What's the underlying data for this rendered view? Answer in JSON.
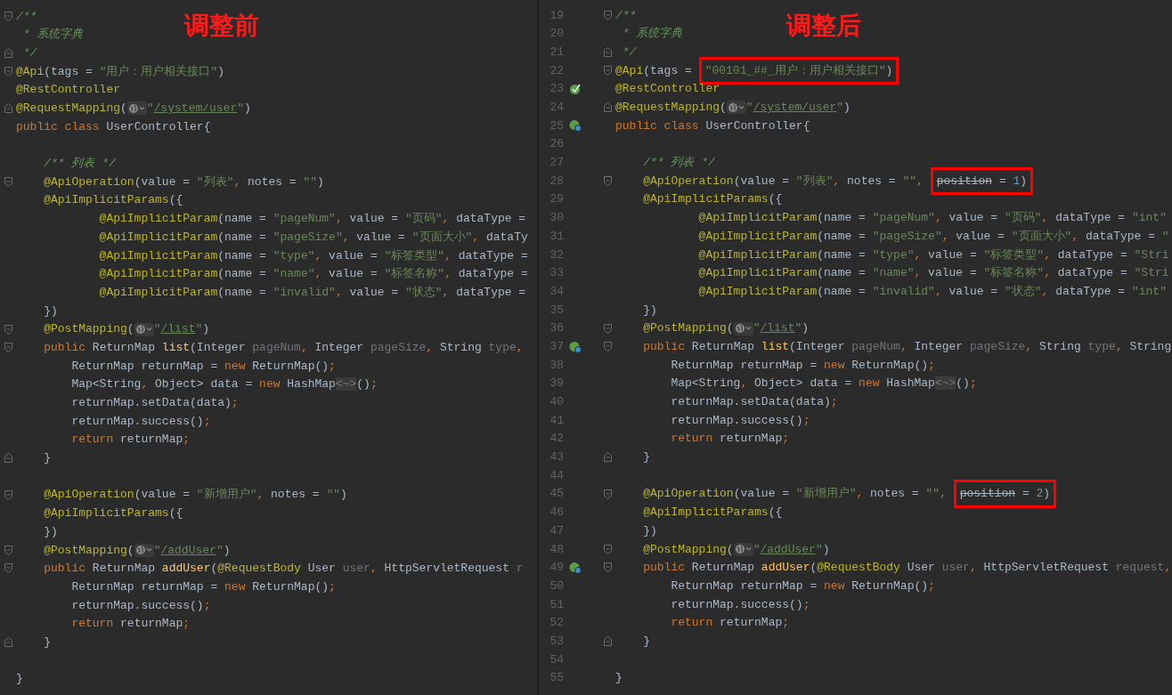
{
  "panes": [
    {
      "heading": "调整前",
      "blocks": [
        {
          "lines": [
            {
              "fold": {
                "kind": "start"
              },
              "tokens": [
                {
                  "kind": "c",
                  "text": "/**"
                }
              ]
            },
            {
              "tokens": [
                {
                  "kind": "c",
                  "text": " * 系统字典"
                }
              ]
            },
            {
              "fold": {
                "kind": "end"
              },
              "tokens": [
                {
                  "kind": "c",
                  "text": " */"
                }
              ]
            },
            {
              "fold": {
                "kind": "start"
              },
              "tokens": [
                {
                  "kind": "a",
                  "text": "@Api"
                },
                {
                  "kind": "p",
                  "text": "(tags = "
                },
                {
                  "kind": "s",
                  "text": "\"用户：用户相关接口\""
                },
                {
                  "kind": "p",
                  "text": ")"
                }
              ]
            },
            {
              "tokens": [
                {
                  "kind": "a",
                  "text": "@RestController"
                }
              ]
            },
            {
              "fold": {
                "kind": "end"
              },
              "tokens": [
                {
                  "kind": "a",
                  "text": "@RequestMapping"
                },
                {
                  "kind": "p",
                  "text": "("
                },
                {
                  "kind": "globe"
                },
                {
                  "kind": "s",
                  "text": "\""
                },
                {
                  "kind": "u",
                  "text": "/system/user"
                },
                {
                  "kind": "s",
                  "text": "\""
                },
                {
                  "kind": "p",
                  "text": ")"
                }
              ]
            },
            {
              "tokens": [
                {
                  "kind": "k",
                  "text": "public class "
                },
                {
                  "kind": "p",
                  "text": "UserController{"
                }
              ]
            }
          ]
        },
        {
          "lines": [
            {
              "tokens": [
                {
                  "kind": "c",
                  "text": "    /** 列表 */"
                }
              ]
            },
            {
              "fold": {
                "kind": "start"
              },
              "tokens": [
                {
                  "kind": "a",
                  "text": "    @ApiOperation"
                },
                {
                  "kind": "p",
                  "text": "(value = "
                },
                {
                  "kind": "s",
                  "text": "\"列表\""
                },
                {
                  "kind": "k",
                  "text": ", "
                },
                {
                  "kind": "p",
                  "text": "notes = "
                },
                {
                  "kind": "s",
                  "text": "\"\""
                },
                {
                  "kind": "p",
                  "text": ")"
                }
              ]
            },
            {
              "tokens": [
                {
                  "kind": "a",
                  "text": "    @ApiImplicitParams"
                },
                {
                  "kind": "p",
                  "text": "({"
                }
              ]
            },
            {
              "tokens": [
                {
                  "kind": "a",
                  "text": "            @ApiImplicitParam"
                },
                {
                  "kind": "p",
                  "text": "(name = "
                },
                {
                  "kind": "s",
                  "text": "\"pageNum\""
                },
                {
                  "kind": "k",
                  "text": ", "
                },
                {
                  "kind": "p",
                  "text": "value = "
                },
                {
                  "kind": "s",
                  "text": "\"页码\""
                },
                {
                  "kind": "k",
                  "text": ", "
                },
                {
                  "kind": "p",
                  "text": "dataType ="
                }
              ]
            },
            {
              "tokens": [
                {
                  "kind": "a",
                  "text": "            @ApiImplicitParam"
                },
                {
                  "kind": "p",
                  "text": "(name = "
                },
                {
                  "kind": "s",
                  "text": "\"pageSize\""
                },
                {
                  "kind": "k",
                  "text": ", "
                },
                {
                  "kind": "p",
                  "text": "value = "
                },
                {
                  "kind": "s",
                  "text": "\"页面大小\""
                },
                {
                  "kind": "k",
                  "text": ", "
                },
                {
                  "kind": "p",
                  "text": "dataTy"
                }
              ]
            },
            {
              "tokens": [
                {
                  "kind": "a",
                  "text": "            @ApiImplicitParam"
                },
                {
                  "kind": "p",
                  "text": "(name = "
                },
                {
                  "kind": "s",
                  "text": "\"type\""
                },
                {
                  "kind": "k",
                  "text": ", "
                },
                {
                  "kind": "p",
                  "text": "value = "
                },
                {
                  "kind": "s",
                  "text": "\"标签类型\""
                },
                {
                  "kind": "k",
                  "text": ", "
                },
                {
                  "kind": "p",
                  "text": "dataType ="
                }
              ]
            },
            {
              "tokens": [
                {
                  "kind": "a",
                  "text": "            @ApiImplicitParam"
                },
                {
                  "kind": "p",
                  "text": "(name = "
                },
                {
                  "kind": "s",
                  "text": "\"name\""
                },
                {
                  "kind": "k",
                  "text": ", "
                },
                {
                  "kind": "p",
                  "text": "value = "
                },
                {
                  "kind": "s",
                  "text": "\"标签名称\""
                },
                {
                  "kind": "k",
                  "text": ", "
                },
                {
                  "kind": "p",
                  "text": "dataType ="
                }
              ]
            },
            {
              "tokens": [
                {
                  "kind": "a",
                  "text": "            @ApiImplicitParam"
                },
                {
                  "kind": "p",
                  "text": "(name = "
                },
                {
                  "kind": "s",
                  "text": "\"invalid\""
                },
                {
                  "kind": "k",
                  "text": ", "
                },
                {
                  "kind": "p",
                  "text": "value = "
                },
                {
                  "kind": "s",
                  "text": "\"状态\""
                },
                {
                  "kind": "k",
                  "text": ", "
                },
                {
                  "kind": "p",
                  "text": "dataType ="
                }
              ]
            },
            {
              "tokens": [
                {
                  "kind": "p",
                  "text": "    })"
                }
              ]
            },
            {
              "fold": {
                "kind": "start"
              },
              "tokens": [
                {
                  "kind": "a",
                  "text": "    @PostMapping"
                },
                {
                  "kind": "p",
                  "text": "("
                },
                {
                  "kind": "globe"
                },
                {
                  "kind": "s",
                  "text": "\""
                },
                {
                  "kind": "u",
                  "text": "/list"
                },
                {
                  "kind": "s",
                  "text": "\""
                },
                {
                  "kind": "p",
                  "text": ")"
                }
              ]
            },
            {
              "fold": {
                "kind": "start"
              },
              "tokens": [
                {
                  "kind": "k",
                  "text": "    public "
                },
                {
                  "kind": "p",
                  "text": "ReturnMap "
                },
                {
                  "kind": "m",
                  "text": "list"
                },
                {
                  "kind": "p",
                  "text": "(Integer "
                },
                {
                  "kind": "g",
                  "text": "pageNum"
                },
                {
                  "kind": "k",
                  "text": ", "
                },
                {
                  "kind": "p",
                  "text": "Integer "
                },
                {
                  "kind": "g",
                  "text": "pageSize"
                },
                {
                  "kind": "k",
                  "text": ", "
                },
                {
                  "kind": "p",
                  "text": "String "
                },
                {
                  "kind": "g",
                  "text": "type"
                },
                {
                  "kind": "k",
                  "text": ","
                }
              ]
            },
            {
              "tokens": [
                {
                  "kind": "p",
                  "text": "        ReturnMap returnMap = "
                },
                {
                  "kind": "k",
                  "text": "new "
                },
                {
                  "kind": "p",
                  "text": "ReturnMap()"
                },
                {
                  "kind": "k",
                  "text": ";"
                }
              ]
            },
            {
              "tokens": [
                {
                  "kind": "p",
                  "text": "        Map<String"
                },
                {
                  "kind": "k",
                  "text": ", "
                },
                {
                  "kind": "p",
                  "text": "Object> data = "
                },
                {
                  "kind": "k",
                  "text": "new "
                },
                {
                  "kind": "p",
                  "text": "HashMap"
                },
                {
                  "kind": "h",
                  "text": "<~>"
                },
                {
                  "kind": "p",
                  "text": "()"
                },
                {
                  "kind": "k",
                  "text": ";"
                }
              ]
            },
            {
              "tokens": [
                {
                  "kind": "p",
                  "text": "        returnMap.setData(data)"
                },
                {
                  "kind": "k",
                  "text": ";"
                }
              ]
            },
            {
              "tokens": [
                {
                  "kind": "p",
                  "text": "        returnMap.success()"
                },
                {
                  "kind": "k",
                  "text": ";"
                }
              ]
            },
            {
              "tokens": [
                {
                  "kind": "k",
                  "text": "        return "
                },
                {
                  "kind": "p",
                  "text": "returnMap"
                },
                {
                  "kind": "k",
                  "text": ";"
                }
              ]
            },
            {
              "fold": {
                "kind": "end"
              },
              "tokens": [
                {
                  "kind": "p",
                  "text": "    }"
                }
              ]
            }
          ]
        },
        {
          "lines": [
            {
              "fold": {
                "kind": "start"
              },
              "tokens": [
                {
                  "kind": "a",
                  "text": "    @ApiOperation"
                },
                {
                  "kind": "p",
                  "text": "(value = "
                },
                {
                  "kind": "s",
                  "text": "\"新增用户\""
                },
                {
                  "kind": "k",
                  "text": ", "
                },
                {
                  "kind": "p",
                  "text": "notes = "
                },
                {
                  "kind": "s",
                  "text": "\"\""
                },
                {
                  "kind": "p",
                  "text": ")"
                }
              ]
            },
            {
              "tokens": [
                {
                  "kind": "a",
                  "text": "    @ApiImplicitParams"
                },
                {
                  "kind": "p",
                  "text": "({"
                }
              ]
            },
            {
              "tokens": [
                {
                  "kind": "p",
                  "text": "    })"
                }
              ]
            },
            {
              "fold": {
                "kind": "start"
              },
              "tokens": [
                {
                  "kind": "a",
                  "text": "    @PostMapping"
                },
                {
                  "kind": "p",
                  "text": "("
                },
                {
                  "kind": "globe"
                },
                {
                  "kind": "s",
                  "text": "\""
                },
                {
                  "kind": "u",
                  "text": "/addUser"
                },
                {
                  "kind": "s",
                  "text": "\""
                },
                {
                  "kind": "p",
                  "text": ")"
                }
              ]
            },
            {
              "fold": {
                "kind": "start"
              },
              "tokens": [
                {
                  "kind": "k",
                  "text": "    public "
                },
                {
                  "kind": "p",
                  "text": "ReturnMap "
                },
                {
                  "kind": "m",
                  "text": "addUser"
                },
                {
                  "kind": "p",
                  "text": "("
                },
                {
                  "kind": "a",
                  "text": "@RequestBody"
                },
                {
                  "kind": "p",
                  "text": " User "
                },
                {
                  "kind": "g",
                  "text": "user"
                },
                {
                  "kind": "k",
                  "text": ", "
                },
                {
                  "kind": "p",
                  "text": "HttpServletRequest "
                },
                {
                  "kind": "g",
                  "text": "r"
                }
              ]
            },
            {
              "tokens": [
                {
                  "kind": "p",
                  "text": "        ReturnMap returnMap = "
                },
                {
                  "kind": "k",
                  "text": "new "
                },
                {
                  "kind": "p",
                  "text": "ReturnMap()"
                },
                {
                  "kind": "k",
                  "text": ";"
                }
              ]
            },
            {
              "tokens": [
                {
                  "kind": "p",
                  "text": "        returnMap.success()"
                },
                {
                  "kind": "k",
                  "text": ";"
                }
              ]
            },
            {
              "tokens": [
                {
                  "kind": "k",
                  "text": "        return "
                },
                {
                  "kind": "p",
                  "text": "returnMap"
                },
                {
                  "kind": "k",
                  "text": ";"
                }
              ]
            },
            {
              "fold": {
                "kind": "end"
              },
              "tokens": [
                {
                  "kind": "p",
                  "text": "    }"
                }
              ]
            }
          ]
        },
        {
          "lines": [
            {
              "tokens": [
                {
                  "kind": "p",
                  "text": "}"
                }
              ]
            }
          ]
        }
      ]
    },
    {
      "heading": "调整后",
      "lines": [
        {
          "number": "19",
          "fold": {
            "kind": "start"
          },
          "tokens": [
            {
              "kind": "c",
              "text": "/**"
            }
          ]
        },
        {
          "number": "20",
          "tokens": [
            {
              "kind": "c",
              "text": " * 系统字典"
            }
          ]
        },
        {
          "number": "21",
          "fold": {
            "kind": "end"
          },
          "tokens": [
            {
              "kind": "c",
              "text": " */"
            }
          ]
        },
        {
          "number": "22",
          "fold": {
            "kind": "start"
          },
          "tokens": [
            {
              "kind": "a",
              "text": "@Api"
            },
            {
              "kind": "p",
              "text": "(tags = "
            },
            {
              "kind": "box",
              "tokens": [
                {
                  "kind": "s",
                  "text": "\"00101_##_用户：用户相关接口\""
                },
                {
                  "kind": "p",
                  "text": ")"
                }
              ]
            }
          ]
        },
        {
          "number": "23",
          "gutter": {
            "kind": "bean"
          },
          "tokens": [
            {
              "kind": "a",
              "text": "@RestController"
            }
          ]
        },
        {
          "number": "24",
          "fold": {
            "kind": "end"
          },
          "tokens": [
            {
              "kind": "a",
              "text": "@RequestMapping"
            },
            {
              "kind": "p",
              "text": "("
            },
            {
              "kind": "globe"
            },
            {
              "kind": "s",
              "text": "\""
            },
            {
              "kind": "u",
              "text": "/system/user"
            },
            {
              "kind": "s",
              "text": "\""
            },
            {
              "kind": "p",
              "text": ")"
            }
          ]
        },
        {
          "number": "25",
          "gutter": {
            "kind": "bean-web"
          },
          "tokens": [
            {
              "kind": "k",
              "text": "public class "
            },
            {
              "kind": "p",
              "text": "UserController{"
            }
          ]
        },
        {
          "number": "26"
        },
        {
          "number": "27",
          "tokens": [
            {
              "kind": "c",
              "text": "    /** 列表 */"
            }
          ]
        },
        {
          "number": "28",
          "fold": {
            "kind": "start"
          },
          "tokens": [
            {
              "kind": "a",
              "text": "    @ApiOperation"
            },
            {
              "kind": "p",
              "text": "(value = "
            },
            {
              "kind": "s",
              "text": "\"列表\""
            },
            {
              "kind": "k",
              "text": ", "
            },
            {
              "kind": "p",
              "text": "notes = "
            },
            {
              "kind": "s",
              "text": "\"\""
            },
            {
              "kind": "k",
              "text": ", "
            },
            {
              "kind": "box",
              "tokens": [
                {
                  "kind": "d",
                  "text": "position"
                },
                {
                  "kind": "p",
                  "text": " = "
                },
                {
                  "kind": "n",
                  "text": "1"
                },
                {
                  "kind": "p",
                  "text": ")"
                }
              ]
            }
          ]
        },
        {
          "number": "29",
          "tokens": [
            {
              "kind": "a",
              "text": "    @ApiImplicitParams"
            },
            {
              "kind": "p",
              "text": "({"
            }
          ]
        },
        {
          "number": "30",
          "tokens": [
            {
              "kind": "a",
              "text": "            @ApiImplicitParam"
            },
            {
              "kind": "p",
              "text": "(name = "
            },
            {
              "kind": "s",
              "text": "\"pageNum\""
            },
            {
              "kind": "k",
              "text": ", "
            },
            {
              "kind": "p",
              "text": "value = "
            },
            {
              "kind": "s",
              "text": "\"页码\""
            },
            {
              "kind": "k",
              "text": ", "
            },
            {
              "kind": "p",
              "text": "dataType = "
            },
            {
              "kind": "s",
              "text": "\"int\""
            }
          ]
        },
        {
          "number": "31",
          "tokens": [
            {
              "kind": "a",
              "text": "            @ApiImplicitParam"
            },
            {
              "kind": "p",
              "text": "(name = "
            },
            {
              "kind": "s",
              "text": "\"pageSize\""
            },
            {
              "kind": "k",
              "text": ", "
            },
            {
              "kind": "p",
              "text": "value = "
            },
            {
              "kind": "s",
              "text": "\"页面大小\""
            },
            {
              "kind": "k",
              "text": ", "
            },
            {
              "kind": "p",
              "text": "dataType = "
            },
            {
              "kind": "s",
              "text": "\""
            }
          ]
        },
        {
          "number": "32",
          "tokens": [
            {
              "kind": "a",
              "text": "            @ApiImplicitParam"
            },
            {
              "kind": "p",
              "text": "(name = "
            },
            {
              "kind": "s",
              "text": "\"type\""
            },
            {
              "kind": "k",
              "text": ", "
            },
            {
              "kind": "p",
              "text": "value = "
            },
            {
              "kind": "s",
              "text": "\"标签类型\""
            },
            {
              "kind": "k",
              "text": ", "
            },
            {
              "kind": "p",
              "text": "dataType = "
            },
            {
              "kind": "s",
              "text": "\"Stri"
            }
          ]
        },
        {
          "number": "33",
          "tokens": [
            {
              "kind": "a",
              "text": "            @ApiImplicitParam"
            },
            {
              "kind": "p",
              "text": "(name = "
            },
            {
              "kind": "s",
              "text": "\"name\""
            },
            {
              "kind": "k",
              "text": ", "
            },
            {
              "kind": "p",
              "text": "value = "
            },
            {
              "kind": "s",
              "text": "\"标签名称\""
            },
            {
              "kind": "k",
              "text": ", "
            },
            {
              "kind": "p",
              "text": "dataType = "
            },
            {
              "kind": "s",
              "text": "\"Stri"
            }
          ]
        },
        {
          "number": "34",
          "tokens": [
            {
              "kind": "a",
              "text": "            @ApiImplicitParam"
            },
            {
              "kind": "p",
              "text": "(name = "
            },
            {
              "kind": "s",
              "text": "\"invalid\""
            },
            {
              "kind": "k",
              "text": ", "
            },
            {
              "kind": "p",
              "text": "value = "
            },
            {
              "kind": "s",
              "text": "\"状态\""
            },
            {
              "kind": "k",
              "text": ", "
            },
            {
              "kind": "p",
              "text": "dataType = "
            },
            {
              "kind": "s",
              "text": "\"int\""
            }
          ]
        },
        {
          "number": "35",
          "tokens": [
            {
              "kind": "p",
              "text": "    })"
            }
          ]
        },
        {
          "number": "36",
          "fold": {
            "kind": "start"
          },
          "tokens": [
            {
              "kind": "a",
              "text": "    @PostMapping"
            },
            {
              "kind": "p",
              "text": "("
            },
            {
              "kind": "globe"
            },
            {
              "kind": "s",
              "text": "\""
            },
            {
              "kind": "u",
              "text": "/list"
            },
            {
              "kind": "s",
              "text": "\""
            },
            {
              "kind": "p",
              "text": ")"
            }
          ]
        },
        {
          "number": "37",
          "gutter": {
            "kind": "bean-web"
          },
          "fold": {
            "kind": "start"
          },
          "tokens": [
            {
              "kind": "k",
              "text": "    public "
            },
            {
              "kind": "p",
              "text": "ReturnMap "
            },
            {
              "kind": "m",
              "text": "list"
            },
            {
              "kind": "p",
              "text": "(Integer "
            },
            {
              "kind": "g",
              "text": "pageNum"
            },
            {
              "kind": "k",
              "text": ", "
            },
            {
              "kind": "p",
              "text": "Integer "
            },
            {
              "kind": "g",
              "text": "pageSize"
            },
            {
              "kind": "k",
              "text": ", "
            },
            {
              "kind": "p",
              "text": "String "
            },
            {
              "kind": "g",
              "text": "type"
            },
            {
              "kind": "k",
              "text": ", "
            },
            {
              "kind": "p",
              "text": "String"
            }
          ]
        },
        {
          "number": "38",
          "tokens": [
            {
              "kind": "p",
              "text": "        ReturnMap returnMap = "
            },
            {
              "kind": "k",
              "text": "new "
            },
            {
              "kind": "p",
              "text": "ReturnMap()"
            },
            {
              "kind": "k",
              "text": ";"
            }
          ]
        },
        {
          "number": "39",
          "tokens": [
            {
              "kind": "p",
              "text": "        Map<String"
            },
            {
              "kind": "k",
              "text": ", "
            },
            {
              "kind": "p",
              "text": "Object> data = "
            },
            {
              "kind": "k",
              "text": "new "
            },
            {
              "kind": "p",
              "text": "HashMap"
            },
            {
              "kind": "h",
              "text": "<~>"
            },
            {
              "kind": "p",
              "text": "()"
            },
            {
              "kind": "k",
              "text": ";"
            }
          ]
        },
        {
          "number": "40",
          "tokens": [
            {
              "kind": "p",
              "text": "        returnMap.setData(data)"
            },
            {
              "kind": "k",
              "text": ";"
            }
          ]
        },
        {
          "number": "41",
          "tokens": [
            {
              "kind": "p",
              "text": "        returnMap.success()"
            },
            {
              "kind": "k",
              "text": ";"
            }
          ]
        },
        {
          "number": "42",
          "tokens": [
            {
              "kind": "k",
              "text": "        return "
            },
            {
              "kind": "p",
              "text": "returnMap"
            },
            {
              "kind": "k",
              "text": ";"
            }
          ]
        },
        {
          "number": "43",
          "fold": {
            "kind": "end"
          },
          "tokens": [
            {
              "kind": "p",
              "text": "    }"
            }
          ]
        },
        {
          "number": "44"
        },
        {
          "number": "45",
          "fold": {
            "kind": "start"
          },
          "tokens": [
            {
              "kind": "a",
              "text": "    @ApiOperation"
            },
            {
              "kind": "p",
              "text": "(value = "
            },
            {
              "kind": "s",
              "text": "\"新增用户\""
            },
            {
              "kind": "k",
              "text": ", "
            },
            {
              "kind": "p",
              "text": "notes = "
            },
            {
              "kind": "s",
              "text": "\"\""
            },
            {
              "kind": "k",
              "text": ", "
            },
            {
              "kind": "box",
              "tokens": [
                {
                  "kind": "d",
                  "text": "position"
                },
                {
                  "kind": "p",
                  "text": " = "
                },
                {
                  "kind": "n",
                  "text": "2"
                },
                {
                  "kind": "p",
                  "text": ")"
                }
              ]
            }
          ]
        },
        {
          "number": "46",
          "tokens": [
            {
              "kind": "a",
              "text": "    @ApiImplicitParams"
            },
            {
              "kind": "p",
              "text": "({"
            }
          ]
        },
        {
          "number": "47",
          "tokens": [
            {
              "kind": "p",
              "text": "    })"
            }
          ]
        },
        {
          "number": "48",
          "fold": {
            "kind": "start"
          },
          "tokens": [
            {
              "kind": "a",
              "text": "    @PostMapping"
            },
            {
              "kind": "p",
              "text": "("
            },
            {
              "kind": "globe"
            },
            {
              "kind": "s",
              "text": "\""
            },
            {
              "kind": "u",
              "text": "/addUser"
            },
            {
              "kind": "s",
              "text": "\""
            },
            {
              "kind": "p",
              "text": ")"
            }
          ]
        },
        {
          "number": "49",
          "gutter": {
            "kind": "bean-web"
          },
          "fold": {
            "kind": "start"
          },
          "tokens": [
            {
              "kind": "k",
              "text": "    public "
            },
            {
              "kind": "p",
              "text": "ReturnMap "
            },
            {
              "kind": "m",
              "text": "addUser"
            },
            {
              "kind": "p",
              "text": "("
            },
            {
              "kind": "a",
              "text": "@RequestBody"
            },
            {
              "kind": "p",
              "text": " User "
            },
            {
              "kind": "g",
              "text": "user"
            },
            {
              "kind": "k",
              "text": ", "
            },
            {
              "kind": "p",
              "text": "HttpServletRequest "
            },
            {
              "kind": "g",
              "text": "request"
            },
            {
              "kind": "k",
              "text": ","
            }
          ]
        },
        {
          "number": "50",
          "tokens": [
            {
              "kind": "p",
              "text": "        ReturnMap returnMap = "
            },
            {
              "kind": "k",
              "text": "new "
            },
            {
              "kind": "p",
              "text": "ReturnMap()"
            },
            {
              "kind": "k",
              "text": ";"
            }
          ]
        },
        {
          "number": "51",
          "tokens": [
            {
              "kind": "p",
              "text": "        returnMap.success()"
            },
            {
              "kind": "k",
              "text": ";"
            }
          ]
        },
        {
          "number": "52",
          "tokens": [
            {
              "kind": "k",
              "text": "        return "
            },
            {
              "kind": "p",
              "text": "returnMap"
            },
            {
              "kind": "k",
              "text": ";"
            }
          ]
        },
        {
          "number": "53",
          "fold": {
            "kind": "end"
          },
          "tokens": [
            {
              "kind": "p",
              "text": "    }"
            }
          ]
        },
        {
          "number": "54"
        },
        {
          "number": "55",
          "tokens": [
            {
              "kind": "p",
              "text": "}"
            }
          ]
        }
      ]
    }
  ]
}
